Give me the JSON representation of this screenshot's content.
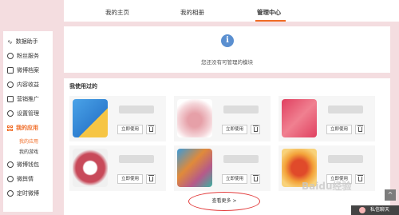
{
  "topnav": {
    "tabs": [
      {
        "label": "我的主页"
      },
      {
        "label": "我的相册"
      },
      {
        "label": "管理中心"
      }
    ]
  },
  "sidebar": {
    "items": [
      {
        "label": "数据助手",
        "icon": "chart-line-icon"
      },
      {
        "label": "粉丝服务",
        "icon": "fans-icon"
      },
      {
        "label": "微博档案",
        "icon": "archive-icon"
      },
      {
        "label": "内容收益",
        "icon": "revenue-icon"
      },
      {
        "label": "营销推广",
        "icon": "promotion-icon"
      },
      {
        "label": "设置管理",
        "icon": "settings-icon"
      },
      {
        "label": "我的应用",
        "icon": "apps-grid-icon"
      },
      {
        "label": "微博钱包",
        "icon": "wallet-icon"
      },
      {
        "label": "微舆情",
        "icon": "opinion-icon"
      },
      {
        "label": "定时微博",
        "icon": "clock-icon"
      }
    ],
    "sub_items": [
      {
        "label": "我的应用"
      },
      {
        "label": "我的游戏"
      }
    ]
  },
  "notice": {
    "text": "您还没有可管理的模块"
  },
  "used_section": {
    "title": "我使用过的",
    "cards": [
      {
        "use_label": "立即使用"
      },
      {
        "use_label": "立即使用"
      },
      {
        "use_label": "立即使用"
      },
      {
        "use_label": "立即使用"
      },
      {
        "use_label": "立即使用"
      },
      {
        "use_label": "立即使用"
      }
    ],
    "more_label": "查看更多 >"
  },
  "floating": {
    "back_top": "^",
    "chat_label": "私信聊天"
  },
  "watermark": "Baidu经验",
  "colors": {
    "accent": "#f06b25",
    "background": "#f4dde0",
    "highlight_ring": "#e23b3b"
  }
}
